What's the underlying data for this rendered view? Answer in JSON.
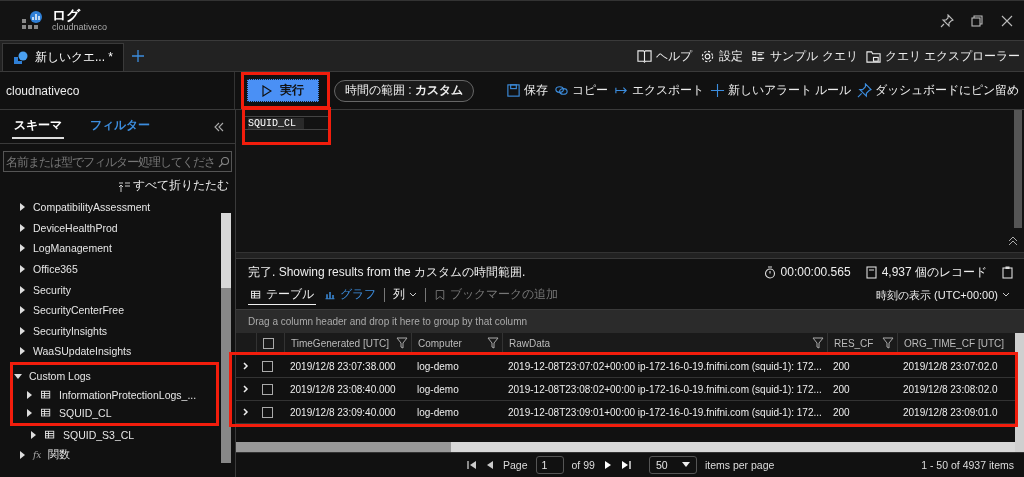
{
  "window": {
    "title": "ログ",
    "subtitle": "cloudnativeco"
  },
  "query_tabs": [
    {
      "label": "新しいクエ... *",
      "selected": true
    }
  ],
  "top_links": [
    {
      "kind": "help",
      "label": "ヘルプ"
    },
    {
      "kind": "settings",
      "label": "設定"
    },
    {
      "kind": "samples",
      "label": "サンプル クエリ"
    },
    {
      "kind": "explorer",
      "label": "クエリ エクスプローラー"
    }
  ],
  "workspace": "cloudnativeco",
  "run_button": {
    "label": "実行",
    "highlighted": true
  },
  "time_range": {
    "label": "時間の範囲 : **カスタム**"
  },
  "actions": [
    {
      "kind": "save",
      "label": "保存"
    },
    {
      "kind": "copy",
      "label": "コピー"
    },
    {
      "kind": "export",
      "label": "エクスポート"
    },
    {
      "kind": "alert",
      "label": "新しいアラート ルール"
    },
    {
      "kind": "pin",
      "label": "ダッシュボードにピン留め"
    }
  ],
  "sidebar": {
    "tabs": [
      {
        "label": "スキーマ",
        "selected": true
      },
      {
        "label": "フィルター",
        "selected": false
      }
    ],
    "search": {
      "placeholder": "名前または型でフィルター処理してくださ"
    },
    "collapse_all": "すべて折りたたむ",
    "tree": [
      {
        "label": "CompatibilityAssessment",
        "kind": "group",
        "expanded": false,
        "highlighted": false
      },
      {
        "label": "DeviceHealthProd",
        "kind": "group",
        "expanded": false,
        "highlighted": false
      },
      {
        "label": "LogManagement",
        "kind": "group",
        "expanded": false,
        "highlighted": false
      },
      {
        "label": "Office365",
        "kind": "group",
        "expanded": false,
        "highlighted": false
      },
      {
        "label": "Security",
        "kind": "group",
        "expanded": false,
        "highlighted": false
      },
      {
        "label": "SecurityCenterFree",
        "kind": "group",
        "expanded": false,
        "highlighted": false
      },
      {
        "label": "SecurityInsights",
        "kind": "group",
        "expanded": false,
        "highlighted": false
      },
      {
        "label": "WaaSUpdateInsights",
        "kind": "group",
        "expanded": false,
        "highlighted": false
      },
      {
        "label": "Custom Logs",
        "kind": "group",
        "expanded": true,
        "highlighted": true,
        "children": [
          {
            "label": "InformationProtectionLogs_...",
            "kind": "table",
            "expanded": false,
            "highlighted": true
          },
          {
            "label": "SQUID_CL",
            "kind": "table",
            "expanded": false,
            "highlighted": true
          },
          {
            "label": "SQUID_S3_CL",
            "kind": "table",
            "expanded": false,
            "highlighted": false
          }
        ]
      },
      {
        "label": "関数",
        "kind": "functions",
        "icon": "fx",
        "expanded": false,
        "highlighted": false
      }
    ]
  },
  "editor": {
    "lines": [
      "SQUID_CL"
    ],
    "highlighted": true
  },
  "results": {
    "status": "完了. Showing results from the カスタムの時間範囲.",
    "duration": "00:00:00.565",
    "record_count": "4,937 個のレコード",
    "view_tabs": [
      {
        "kind": "table",
        "label": "テーブル",
        "selected": true,
        "disabled": false
      },
      {
        "kind": "chart",
        "label": "グラフ",
        "selected": false,
        "disabled": false
      },
      {
        "kind": "columns",
        "label": "列",
        "selected": false,
        "disabled": false
      },
      {
        "kind": "bookmark",
        "label": "ブックマークの追加",
        "selected": false,
        "disabled": true
      }
    ],
    "time_display": "時刻の表示 (UTC+00:00)",
    "group_hint": "Drag a column header and drop it here to group by that column",
    "table": {
      "select_all": {
        "checked": false
      },
      "columns": [
        {
          "label": "TimeGenerated [UTC]",
          "filter": true
        },
        {
          "label": "Computer",
          "filter": true
        },
        {
          "label": "RawData",
          "filter": true
        },
        {
          "label": "RES_CF",
          "filter": true
        },
        {
          "label": "ORG_TIME_CF [UTC]",
          "filter": false
        }
      ],
      "rows": [
        {
          "expanded": false,
          "checked": false,
          "highlighted": true,
          "cells": [
            "2019/12/8 23:07:38.000",
            "log-demo",
            "2019-12-08T23:07:02+00:00 ip-172-16-0-19.fnifni.com (squid-1): 172...",
            "200",
            "2019/12/8 23:07:02.0"
          ]
        },
        {
          "expanded": false,
          "checked": false,
          "highlighted": true,
          "cells": [
            "2019/12/8 23:08:40.000",
            "log-demo",
            "2019-12-08T23:08:02+00:00 ip-172-16-0-19.fnifni.com (squid-1): 172...",
            "200",
            "2019/12/8 23:08:02.0"
          ]
        },
        {
          "expanded": false,
          "checked": false,
          "highlighted": true,
          "cells": [
            "2019/12/8 23:09:40.000",
            "log-demo",
            "2019-12-08T23:09:01+00:00 ip-172-16-0-19.fnifni.com (squid-1): 172...",
            "200",
            "2019/12/8 23:09:01.0"
          ]
        }
      ]
    },
    "pagination": {
      "page_label": "Page",
      "page": "1",
      "of": "of 99",
      "page_size": "50",
      "per_page": "items per page",
      "summary": "1 - 50 of 4937 items"
    }
  }
}
